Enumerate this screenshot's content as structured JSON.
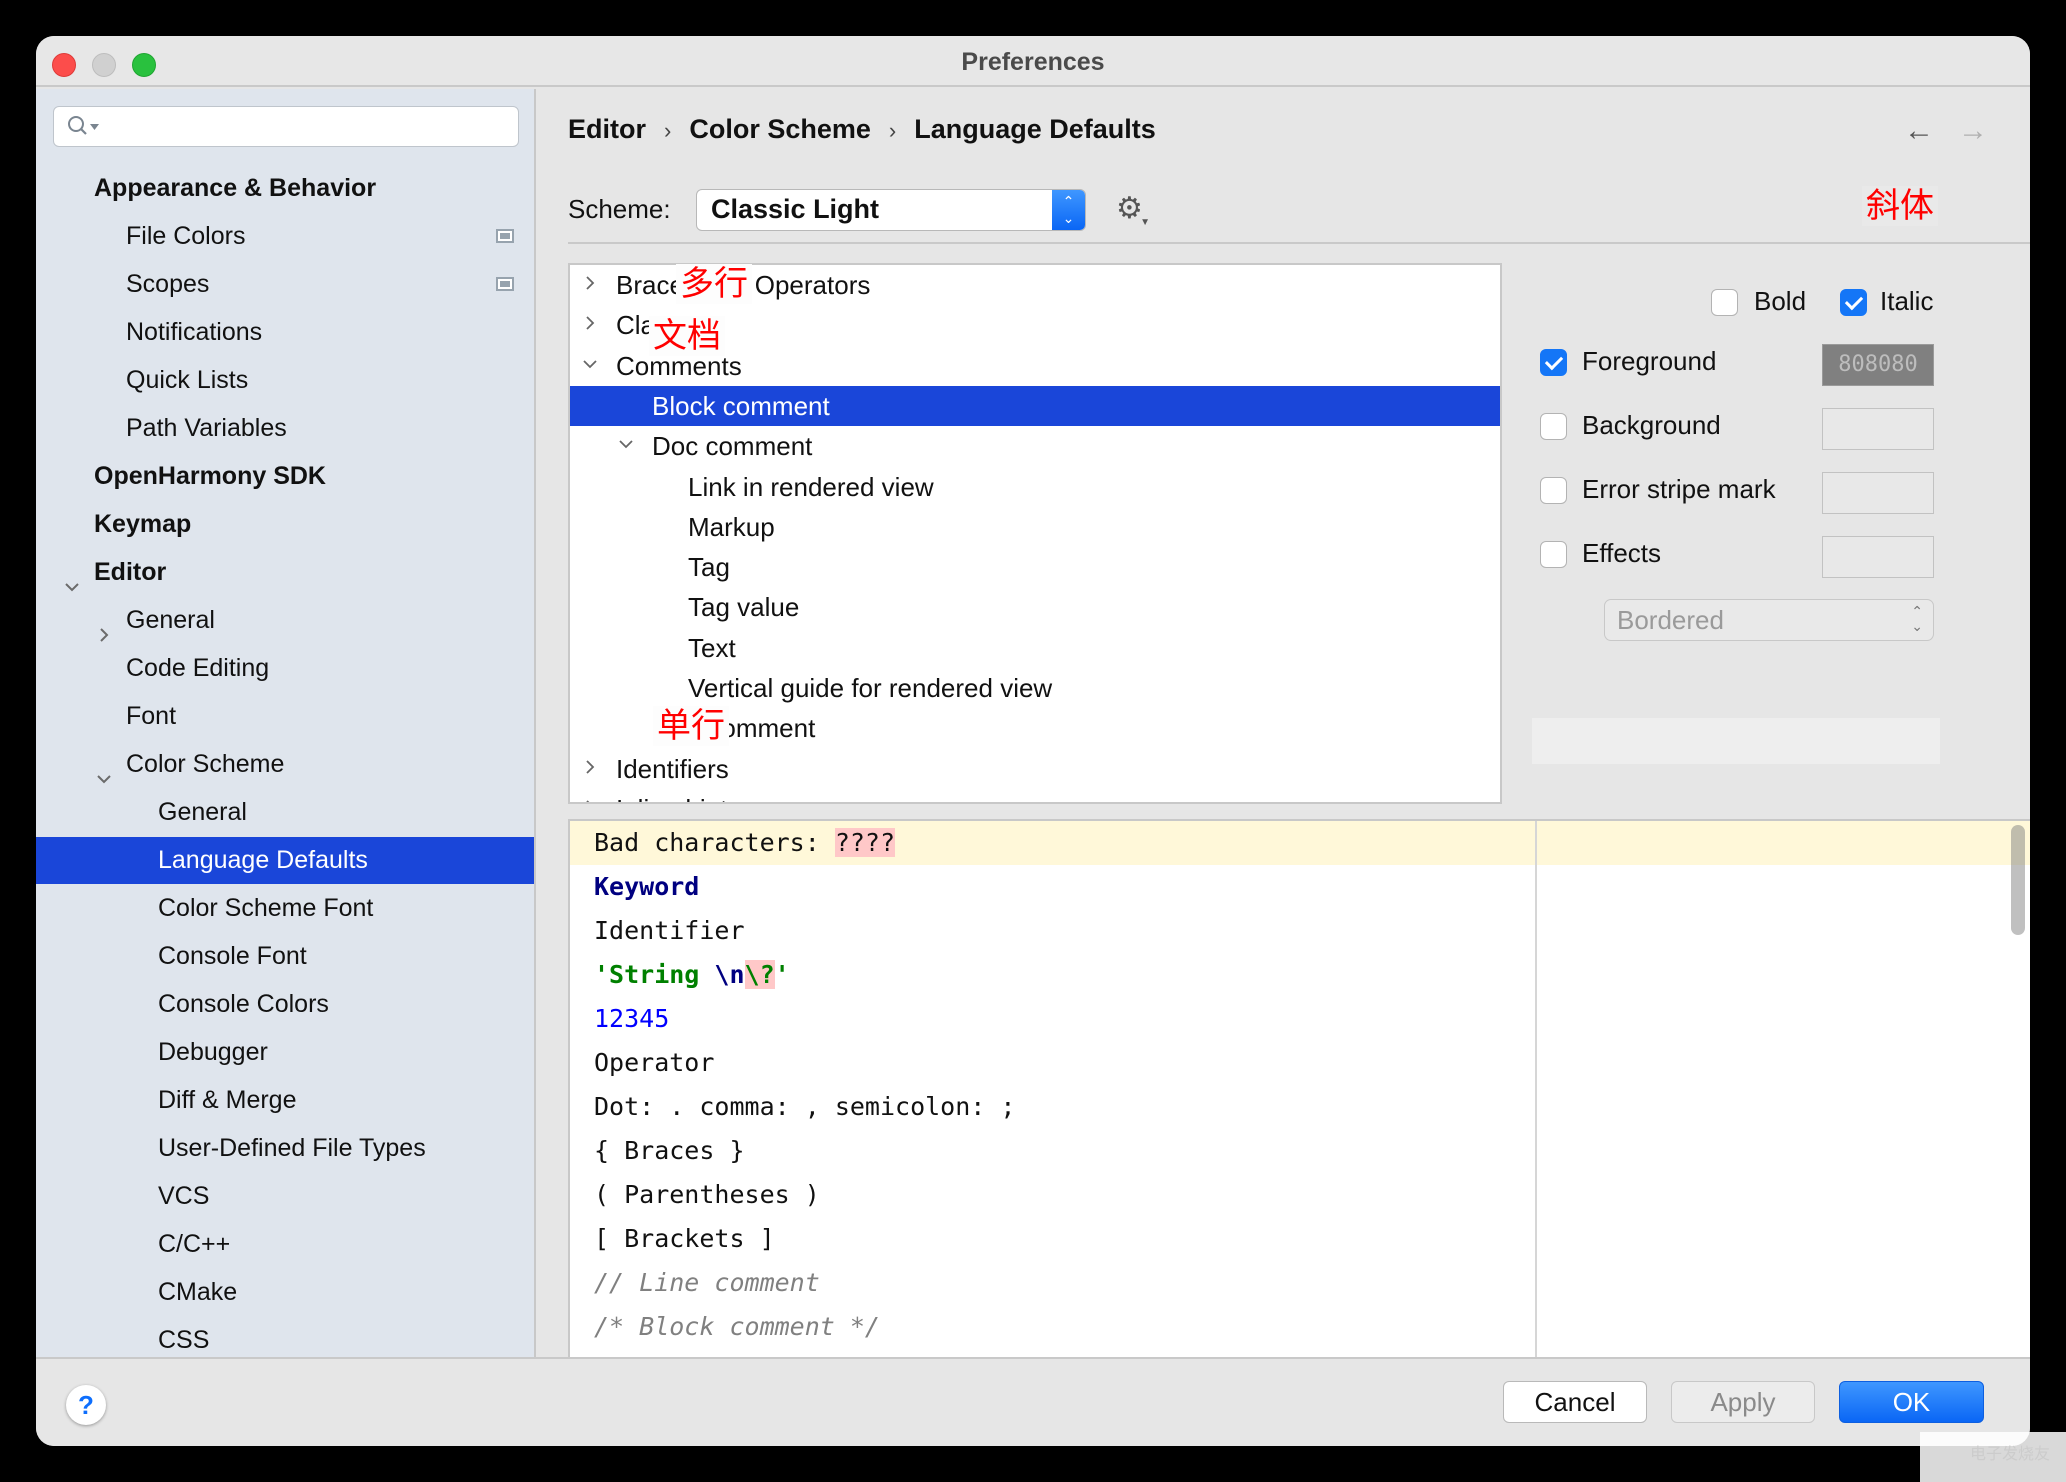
{
  "window": {
    "title": "Preferences"
  },
  "sidebar": {
    "search": {
      "placeholder": "",
      "value": ""
    },
    "items": [
      {
        "label": "Appearance & Behavior",
        "bold": true,
        "indent": 0,
        "chevron": "none"
      },
      {
        "label": "File Colors",
        "indent": 1,
        "project_icon": true
      },
      {
        "label": "Scopes",
        "indent": 1,
        "project_icon": true
      },
      {
        "label": "Notifications",
        "indent": 1
      },
      {
        "label": "Quick Lists",
        "indent": 1
      },
      {
        "label": "Path Variables",
        "indent": 1
      },
      {
        "label": "OpenHarmony SDK",
        "bold": true,
        "indent": 0
      },
      {
        "label": "Keymap",
        "bold": true,
        "indent": 0
      },
      {
        "label": "Editor",
        "bold": true,
        "indent": 0,
        "chevron": "expanded"
      },
      {
        "label": "General",
        "indent": 1,
        "chevron": "collapsed"
      },
      {
        "label": "Code Editing",
        "indent": 1
      },
      {
        "label": "Font",
        "indent": 1
      },
      {
        "label": "Color Scheme",
        "indent": 1,
        "chevron": "expanded"
      },
      {
        "label": "General",
        "indent": 2
      },
      {
        "label": "Language Defaults",
        "indent": 2,
        "selected": true
      },
      {
        "label": "Color Scheme Font",
        "indent": 2
      },
      {
        "label": "Console Font",
        "indent": 2
      },
      {
        "label": "Console Colors",
        "indent": 2
      },
      {
        "label": "Debugger",
        "indent": 2
      },
      {
        "label": "Diff & Merge",
        "indent": 2
      },
      {
        "label": "User-Defined File Types",
        "indent": 2
      },
      {
        "label": "VCS",
        "indent": 2
      },
      {
        "label": "C/C++",
        "indent": 2
      },
      {
        "label": "CMake",
        "indent": 2
      },
      {
        "label": "CSS",
        "indent": 2
      }
    ]
  },
  "breadcrumb": [
    "Editor",
    "Color Scheme",
    "Language Defaults"
  ],
  "nav": {
    "back_icon": "arrow-left-icon",
    "forward_icon": "arrow-right-icon"
  },
  "scheme": {
    "label": "Scheme:",
    "value": "Classic Light"
  },
  "tree": {
    "items": [
      {
        "label": "Braces and Operators",
        "level": 0,
        "chevron": "collapsed"
      },
      {
        "label": "Classes",
        "level": 0,
        "chevron": "collapsed"
      },
      {
        "label": "Comments",
        "level": 0,
        "chevron": "expanded"
      },
      {
        "label": "Block comment",
        "level": 1,
        "selected": true
      },
      {
        "label": "Doc comment",
        "level": 1,
        "chevron": "expanded"
      },
      {
        "label": "Link in rendered view",
        "level": 2
      },
      {
        "label": "Markup",
        "level": 2
      },
      {
        "label": "Tag",
        "level": 2
      },
      {
        "label": "Tag value",
        "level": 2
      },
      {
        "label": "Text",
        "level": 2
      },
      {
        "label": "Vertical guide for rendered view",
        "level": 2
      },
      {
        "label": "Line comment",
        "level": 1
      },
      {
        "label": "Identifiers",
        "level": 0,
        "chevron": "collapsed"
      },
      {
        "label": "Inline hints",
        "level": 0,
        "chevron": "collapsed"
      }
    ],
    "annotations": {
      "block": "多行",
      "doc": "文档",
      "line": "单行",
      "italic": "斜体"
    }
  },
  "attributes": {
    "bold": {
      "label": "Bold",
      "checked": false
    },
    "italic": {
      "label": "Italic",
      "checked": true
    },
    "foreground": {
      "label": "Foreground",
      "checked": true,
      "color": "808080"
    },
    "background": {
      "label": "Background",
      "checked": false,
      "color": ""
    },
    "error_stripe": {
      "label": "Error stripe mark",
      "checked": false,
      "color": ""
    },
    "effects": {
      "label": "Effects",
      "checked": false,
      "color": "",
      "type": "Bordered"
    }
  },
  "preview": {
    "lines": {
      "bad_prefix": "Bad characters: ",
      "bad_chars": "????",
      "keyword": "Keyword",
      "identifier": "Identifier",
      "string_open": "'String ",
      "string_escape": "\\n",
      "string_bad_escape": "\\?",
      "string_close": "'",
      "number": "12345",
      "operator": "Operator",
      "punct": "Dot: . comma: , semicolon: ;",
      "braces": "{ Braces }",
      "parens": "( Parentheses )",
      "brackets": "[ Brackets ]",
      "line_comment": "// Line comment",
      "block_comment": "/* Block comment */"
    }
  },
  "footer": {
    "help": "?",
    "cancel": "Cancel",
    "apply": "Apply",
    "ok": "OK"
  },
  "colors": {
    "accent": "#1a46d9",
    "ok_button": "#0a66f5",
    "annotation": "#ff0000",
    "sidebar_bg": "#dfe5ed"
  },
  "watermark": "电子发烧友"
}
